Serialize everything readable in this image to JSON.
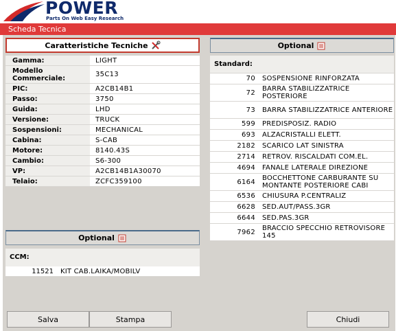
{
  "header": {
    "logo_title": "POWER",
    "logo_subtitle": "Parts On Web Easy Research",
    "page_title": "Scheda Tecnica"
  },
  "specs": {
    "title": "Caratteristiche Tecniche",
    "rows": [
      {
        "label": "Gamma:",
        "value": "LIGHT"
      },
      {
        "label": "Modello Commerciale:",
        "value": "35C13"
      },
      {
        "label": "PIC:",
        "value": "A2CB14B1"
      },
      {
        "label": "Passo:",
        "value": "3750"
      },
      {
        "label": "Guida:",
        "value": "LHD"
      },
      {
        "label": "Versione:",
        "value": "TRUCK"
      },
      {
        "label": "Sospensioni:",
        "value": "MECHANICAL"
      },
      {
        "label": "Cabina:",
        "value": "S-CAB"
      },
      {
        "label": "Motore:",
        "value": "8140.43S"
      },
      {
        "label": "Cambio:",
        "value": "S6-300"
      },
      {
        "label": "VP:",
        "value": "A2CB14B1A30070"
      },
      {
        "label": "Telaio:",
        "value": "ZCFC359100"
      }
    ]
  },
  "optional_right": {
    "title": "Optional",
    "standard_label": "Standard:",
    "items": [
      {
        "code": "70",
        "desc": "SOSPENSIONE RINFORZATA"
      },
      {
        "code": "72",
        "desc": "BARRA STABILIZZATRICE POSTERIORE"
      },
      {
        "code": "73",
        "desc": "BARRA STABILIZZATRICE ANTERIORE"
      },
      {
        "code": "599",
        "desc": "PREDISPOSIZ. RADIO"
      },
      {
        "code": "693",
        "desc": "ALZACRISTALLI ELETT."
      },
      {
        "code": "2182",
        "desc": "SCARICO LAT SINISTRA"
      },
      {
        "code": "2714",
        "desc": "RETROV. RISCALDATI COM.EL."
      },
      {
        "code": "4694",
        "desc": "FANALE LATERALE DIREZIONE"
      },
      {
        "code": "6164",
        "desc": "BOCCHETTONE CARBURANTE SU MONTANTE POSTERIORE CABI"
      },
      {
        "code": "6536",
        "desc": "CHIUSURA P.CENTRALIZ"
      },
      {
        "code": "6628",
        "desc": "SED.AUT/PASS.3GR"
      },
      {
        "code": "6644",
        "desc": "SED.PAS.3GR"
      },
      {
        "code": "7962",
        "desc": "BRACCIO SPECCHIO RETROVISORE 145"
      }
    ]
  },
  "optional_left": {
    "title": "Optional",
    "ccm_label": "CCM:",
    "items": [
      {
        "code": "11521",
        "desc": "KIT CAB.LAIKA/MOBILV"
      }
    ]
  },
  "buttons": {
    "save": "Salva",
    "print": "Stampa",
    "close": "Chiudi"
  },
  "colors": {
    "title_bar": "#e03a3a",
    "panel_bg": "#d6d3ce",
    "brand_blue": "#0f2a6b"
  }
}
